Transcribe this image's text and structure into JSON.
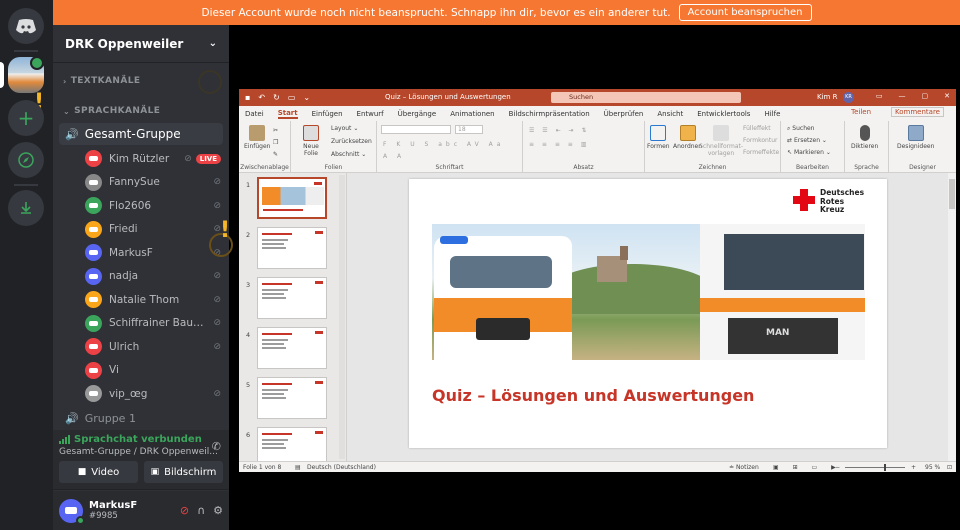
{
  "banner": {
    "message": "Dieser Account wurde noch nicht beansprucht. Schnapp ihn dir, bevor es ein anderer tut.",
    "button": "Account beanspruchen"
  },
  "server": {
    "name": "DRK Oppenweiler",
    "categories": {
      "text": "TEXTKANÄLE",
      "voice": "SPRACHKANÄLE"
    },
    "voice_channel": "Gesamt-Gruppe",
    "second_channel": "Gruppe 1",
    "live_badge": "LIVE",
    "members": [
      {
        "name": "Kim Rützler",
        "color": "#ed4245",
        "live": true
      },
      {
        "name": "FannySue",
        "color": "#888888",
        "live": false
      },
      {
        "name": "Flo2606",
        "color": "#3ba55c",
        "live": false
      },
      {
        "name": "Friedi",
        "color": "#faa61a",
        "live": false
      },
      {
        "name": "MarkusF",
        "color": "#5865f2",
        "live": false
      },
      {
        "name": "nadja",
        "color": "#5865f2",
        "live": false
      },
      {
        "name": "Natalie Thom",
        "color": "#faa61a",
        "live": false
      },
      {
        "name": "Schiffrainer Bauernf...",
        "color": "#3ba55c",
        "live": false
      },
      {
        "name": "Ulrich",
        "color": "#ed4245",
        "live": false
      },
      {
        "name": "Vi",
        "color": "#ed4245",
        "live": false
      },
      {
        "name": "vip_œg",
        "color": "#999999",
        "live": false
      }
    ]
  },
  "voice_panel": {
    "status": "Sprachchat verbunden",
    "location": "Gesamt-Gruppe / DRK Oppenweil...",
    "video_button": "Video",
    "screen_button": "Bildschirm"
  },
  "user_panel": {
    "name": "MarkusF",
    "tag": "#9985"
  },
  "ppt": {
    "title": "Quiz – Lösungen und Auswertungen",
    "search": "Suchen",
    "user": "Kim R",
    "user_initials": "KR",
    "tabs": [
      "Datei",
      "Start",
      "Einfügen",
      "Entwurf",
      "Übergänge",
      "Animationen",
      "Bildschirmpräsentation",
      "Überprüfen",
      "Ansicht",
      "Entwicklertools",
      "Hilfe"
    ],
    "active_tab": "Start",
    "share": "Teilen",
    "comments": "Kommentare",
    "ribbon": {
      "clipboard_label": "Zwischenablage",
      "paste": "Einfügen",
      "slides_label": "Folien",
      "new_slide": "Neue Folie",
      "layout": "Layout",
      "reset": "Zurücksetzen",
      "section": "Abschnitt",
      "font_label": "Schriftart",
      "font_size": "18",
      "paragraph_label": "Absatz",
      "drawing_label": "Zeichnen",
      "shapes": "Formen",
      "arrange": "Anordnen",
      "quick_styles": "Schnellformat-vorlagen",
      "fill": "Fülleffekt",
      "outline": "Formkontur",
      "effects": "Formeffekte",
      "editing_label": "Bearbeiten",
      "find": "Suchen",
      "replace": "Ersetzen",
      "select": "Markieren",
      "voice_label": "Sprache",
      "dictate": "Diktieren",
      "designer_label": "Designer",
      "designer": "Designideen"
    },
    "slide_numbers": [
      "1",
      "2",
      "3",
      "4",
      "5",
      "6"
    ],
    "slide": {
      "logo_lines": [
        "Deutsches",
        "Rotes",
        "Kreuz"
      ],
      "truck_text": "MAN",
      "title": "Quiz – Lösungen und Auswertungen"
    },
    "status": {
      "slide_info": "Folie 1 von 8",
      "language": "Deutsch (Deutschland)",
      "notes": "Notizen",
      "zoom": "95 %"
    }
  }
}
